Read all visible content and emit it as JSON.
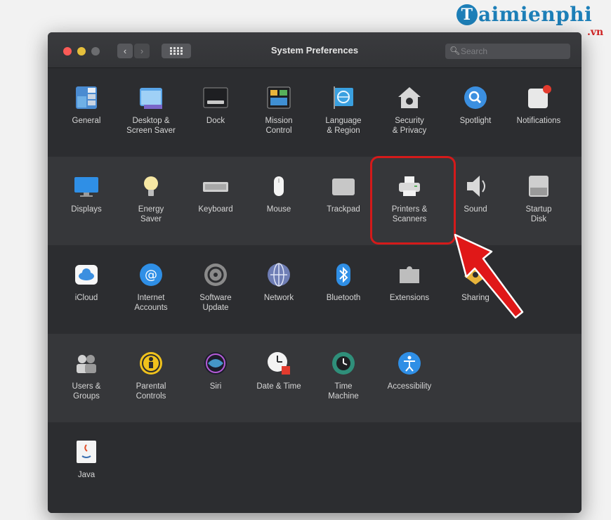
{
  "window": {
    "title": "System Preferences"
  },
  "search": {
    "placeholder": "Search"
  },
  "watermark": {
    "brand": "aimienphi",
    "brand_initial": "T",
    "suffix": ".vn"
  },
  "highlighted_item": "Printers & Scanners",
  "rows": [
    [
      {
        "key": "general",
        "label": "General",
        "icon": "general-icon"
      },
      {
        "key": "desktop",
        "label": "Desktop &\nScreen Saver",
        "icon": "desktop-screensaver-icon"
      },
      {
        "key": "dock",
        "label": "Dock",
        "icon": "dock-icon"
      },
      {
        "key": "mission",
        "label": "Mission\nControl",
        "icon": "mission-control-icon"
      },
      {
        "key": "language",
        "label": "Language\n& Region",
        "icon": "language-region-icon"
      },
      {
        "key": "security",
        "label": "Security\n& Privacy",
        "icon": "security-privacy-icon"
      },
      {
        "key": "spotlight",
        "label": "Spotlight",
        "icon": "spotlight-icon"
      },
      {
        "key": "notifications",
        "label": "Notifications",
        "icon": "notifications-icon"
      }
    ],
    [
      {
        "key": "displays",
        "label": "Displays",
        "icon": "displays-icon"
      },
      {
        "key": "energy",
        "label": "Energy\nSaver",
        "icon": "energy-saver-icon"
      },
      {
        "key": "keyboard",
        "label": "Keyboard",
        "icon": "keyboard-icon"
      },
      {
        "key": "mouse",
        "label": "Mouse",
        "icon": "mouse-icon"
      },
      {
        "key": "trackpad",
        "label": "Trackpad",
        "icon": "trackpad-icon"
      },
      {
        "key": "printers",
        "label": "Printers &\nScanners",
        "icon": "printer-icon"
      },
      {
        "key": "sound",
        "label": "Sound",
        "icon": "sound-icon"
      },
      {
        "key": "startup",
        "label": "Startup\nDisk",
        "icon": "startup-disk-icon"
      }
    ],
    [
      {
        "key": "icloud",
        "label": "iCloud",
        "icon": "icloud-icon"
      },
      {
        "key": "internet",
        "label": "Internet\nAccounts",
        "icon": "internet-accounts-icon"
      },
      {
        "key": "software",
        "label": "Software\nUpdate",
        "icon": "software-update-icon"
      },
      {
        "key": "network",
        "label": "Network",
        "icon": "network-icon"
      },
      {
        "key": "bluetooth",
        "label": "Bluetooth",
        "icon": "bluetooth-icon"
      },
      {
        "key": "extensions",
        "label": "Extensions",
        "icon": "extensions-icon"
      },
      {
        "key": "sharing",
        "label": "Sharing",
        "icon": "sharing-icon"
      }
    ],
    [
      {
        "key": "users",
        "label": "Users &\nGroups",
        "icon": "users-groups-icon"
      },
      {
        "key": "parental",
        "label": "Parental\nControls",
        "icon": "parental-controls-icon"
      },
      {
        "key": "siri",
        "label": "Siri",
        "icon": "siri-icon"
      },
      {
        "key": "datetime",
        "label": "Date & Time",
        "icon": "date-time-icon"
      },
      {
        "key": "timemachine",
        "label": "Time\nMachine",
        "icon": "time-machine-icon"
      },
      {
        "key": "accessibility",
        "label": "Accessibility",
        "icon": "accessibility-icon"
      }
    ],
    [
      {
        "key": "java",
        "label": "Java",
        "icon": "java-icon"
      }
    ]
  ]
}
